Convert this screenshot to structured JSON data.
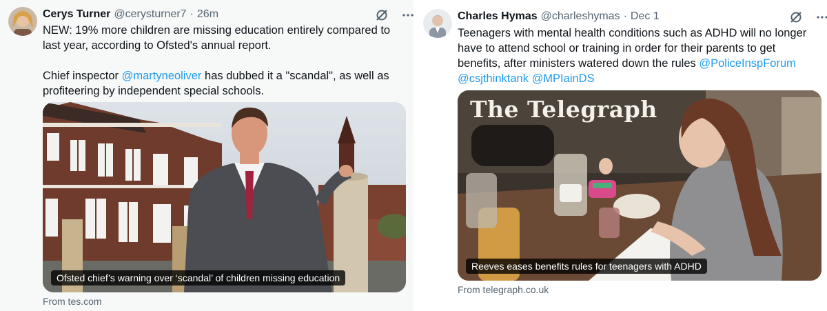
{
  "left_tweet": {
    "author_name": "Cerys Turner",
    "author_handle": "@cerysturner7",
    "separator": "·",
    "time": "26m",
    "text_line1": "NEW: 19% more children are missing education entirely compared to last year, according to Ofsted's annual report.",
    "text_p2_before": "Chief inspector ",
    "text_p2_mention": "@martyneoliver",
    "text_p2_after": " has dubbed it a \"scandal\", as well as profiteering by independent special schools.",
    "card_caption": "Ofsted chief’s warning over ‘scandal’ of children missing education",
    "card_source": "From tes.com",
    "icons": [
      "grok-icon",
      "more-icon"
    ]
  },
  "right_tweet": {
    "author_name": "Charles Hymas",
    "author_handle": "@charleshymas",
    "separator": "·",
    "time": "Dec 1",
    "text_before": "Teenagers with mental health conditions such as ADHD will no longer have to attend school or training in order for their parents to get benefits, after ministers watered down the rules ",
    "mention1": "@PoliceInspForum",
    "mention2": "@csjthinktank",
    "mention3": "@MPIainDS",
    "card_masthead": "The Telegraph",
    "card_caption": "Reeves eases benefits rules for teenagers with ADHD",
    "card_source": "From telegraph.co.uk",
    "icons": [
      "grok-icon",
      "more-icon"
    ]
  },
  "colors": {
    "link": "#1d9bf0",
    "secondary_text": "#536471",
    "primary_text": "#0f1419"
  }
}
